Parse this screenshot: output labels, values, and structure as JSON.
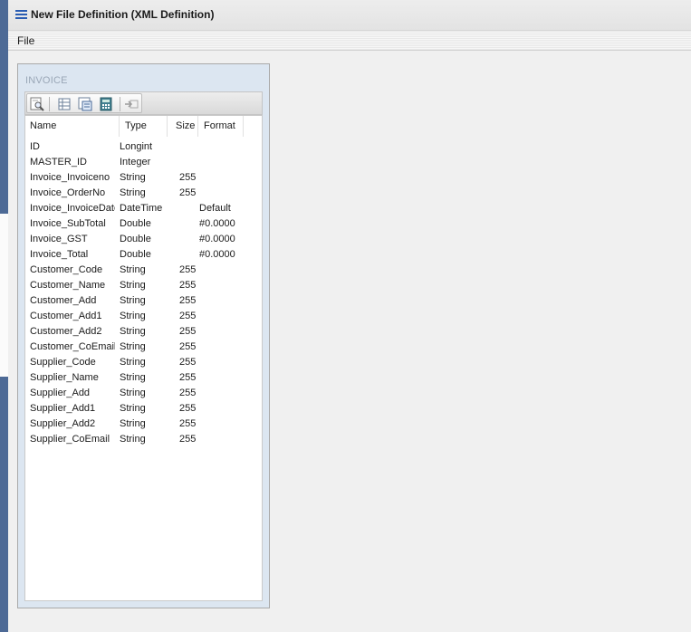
{
  "window": {
    "title": "New File Definition (XML Definition)"
  },
  "menu": {
    "file": "File"
  },
  "panel": {
    "title": "INVOICE",
    "toolbar_icons": [
      "find-icon",
      "grid-view-icon",
      "form-view-icon",
      "calculator-icon",
      "import-icon"
    ]
  },
  "columns": {
    "name": "Name",
    "type": "Type",
    "size": "Size",
    "format": "Format"
  },
  "fields": [
    {
      "name": "ID",
      "type": "Longint",
      "size": "",
      "format": ""
    },
    {
      "name": "MASTER_ID",
      "type": "Integer",
      "size": "",
      "format": ""
    },
    {
      "name": "Invoice_Invoiceno",
      "type": "String",
      "size": "255",
      "format": ""
    },
    {
      "name": "Invoice_OrderNo",
      "type": "String",
      "size": "255",
      "format": ""
    },
    {
      "name": "Invoice_InvoiceDate",
      "type": "DateTime",
      "size": "",
      "format": "Default"
    },
    {
      "name": "Invoice_SubTotal",
      "type": "Double",
      "size": "",
      "format": "#0.0000"
    },
    {
      "name": "Invoice_GST",
      "type": "Double",
      "size": "",
      "format": "#0.0000"
    },
    {
      "name": "Invoice_Total",
      "type": "Double",
      "size": "",
      "format": "#0.0000"
    },
    {
      "name": "Customer_Code",
      "type": "String",
      "size": "255",
      "format": ""
    },
    {
      "name": "Customer_Name",
      "type": "String",
      "size": "255",
      "format": ""
    },
    {
      "name": "Customer_Add",
      "type": "String",
      "size": "255",
      "format": ""
    },
    {
      "name": "Customer_Add1",
      "type": "String",
      "size": "255",
      "format": ""
    },
    {
      "name": "Customer_Add2",
      "type": "String",
      "size": "255",
      "format": ""
    },
    {
      "name": "Customer_CoEmail",
      "type": "String",
      "size": "255",
      "format": ""
    },
    {
      "name": "Supplier_Code",
      "type": "String",
      "size": "255",
      "format": ""
    },
    {
      "name": "Supplier_Name",
      "type": "String",
      "size": "255",
      "format": ""
    },
    {
      "name": "Supplier_Add",
      "type": "String",
      "size": "255",
      "format": ""
    },
    {
      "name": "Supplier_Add1",
      "type": "String",
      "size": "255",
      "format": ""
    },
    {
      "name": "Supplier_Add2",
      "type": "String",
      "size": "255",
      "format": ""
    },
    {
      "name": "Supplier_CoEmail",
      "type": "String",
      "size": "255",
      "format": ""
    }
  ],
  "colors": {
    "title_icon": "#2a5db3",
    "panel_bg": "#dce6f1",
    "panel_title": "#9aa7b7"
  }
}
